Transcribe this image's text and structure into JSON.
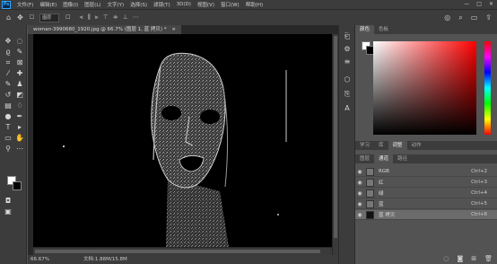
{
  "app": {
    "logo_text": "Ps",
    "menu": [
      "文件(F)",
      "编辑(E)",
      "图像(I)",
      "图层(L)",
      "文字(Y)",
      "选择(S)",
      "滤镜(T)",
      "3D(D)",
      "视图(V)",
      "窗口(W)",
      "帮助(H)"
    ],
    "window_controls": [
      "—",
      "□",
      "✕"
    ]
  },
  "options_bar": {
    "mode_select": "图层"
  },
  "document": {
    "tab_title": "woman-3990680_1920.jpg @ 66.7% (图层 1, 蓝 拷贝) *",
    "tab_close": "×",
    "zoom_label": "66.67%",
    "doc_info": "文档:1.88M/15.8M"
  },
  "right_panel": {
    "color_tabs": [
      "颜色",
      "色板"
    ],
    "mid_tabs": [
      "学习",
      "库",
      "调整",
      "动作"
    ],
    "layer_tabs": [
      "图层",
      "通道",
      "路径"
    ],
    "channels": [
      {
        "name": "RGB",
        "shortcut": "Ctrl+2",
        "visible": true,
        "selected": false
      },
      {
        "name": "红",
        "shortcut": "Ctrl+3",
        "visible": true,
        "selected": false
      },
      {
        "name": "绿",
        "shortcut": "Ctrl+4",
        "visible": true,
        "selected": false
      },
      {
        "name": "蓝",
        "shortcut": "Ctrl+5",
        "visible": true,
        "selected": false
      },
      {
        "name": "蓝 拷贝",
        "shortcut": "Ctrl+6",
        "visible": true,
        "selected": true
      }
    ]
  },
  "colors": {
    "foreground": "#ffffff",
    "background": "#000000",
    "accent": "#31a8ff"
  }
}
